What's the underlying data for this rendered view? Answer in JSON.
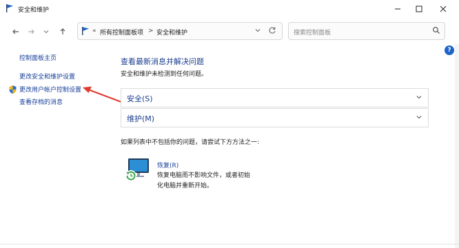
{
  "window": {
    "title": "安全和维护",
    "minimize_icon": "minimize-icon",
    "maximize_icon": "maximize-icon",
    "close_icon": "close-icon"
  },
  "address_bar": {
    "prefix": "«",
    "crumbs": [
      "所有控制面板项",
      "安全和维护"
    ],
    "separator": ">"
  },
  "search": {
    "placeholder": "搜索控制面板"
  },
  "help_label": "?",
  "sidebar": {
    "items": [
      {
        "label": "控制面板主页"
      },
      {
        "label": "更改安全和维护设置"
      },
      {
        "label": "更改用户帐户控制设置"
      },
      {
        "label": "查看存档的消息"
      }
    ]
  },
  "main": {
    "heading": "查看最新消息并解决问题",
    "subtext": "安全和维护未检测到任何问题。",
    "sections": [
      {
        "label": "安全(S)"
      },
      {
        "label": "维护(M)"
      }
    ],
    "not_found_text": "如果列表中不包括你的问题，请尝试下方方法之一:",
    "recovery": {
      "link": "恢复(R)",
      "description": "恢复电脑而不影响文件，或者初始化电脑并重新开始。"
    }
  },
  "colors": {
    "link": "#173f9a",
    "heading": "#1a3d8f",
    "annotation_arrow": "#e03c31",
    "help_badge": "#1f63c8"
  }
}
